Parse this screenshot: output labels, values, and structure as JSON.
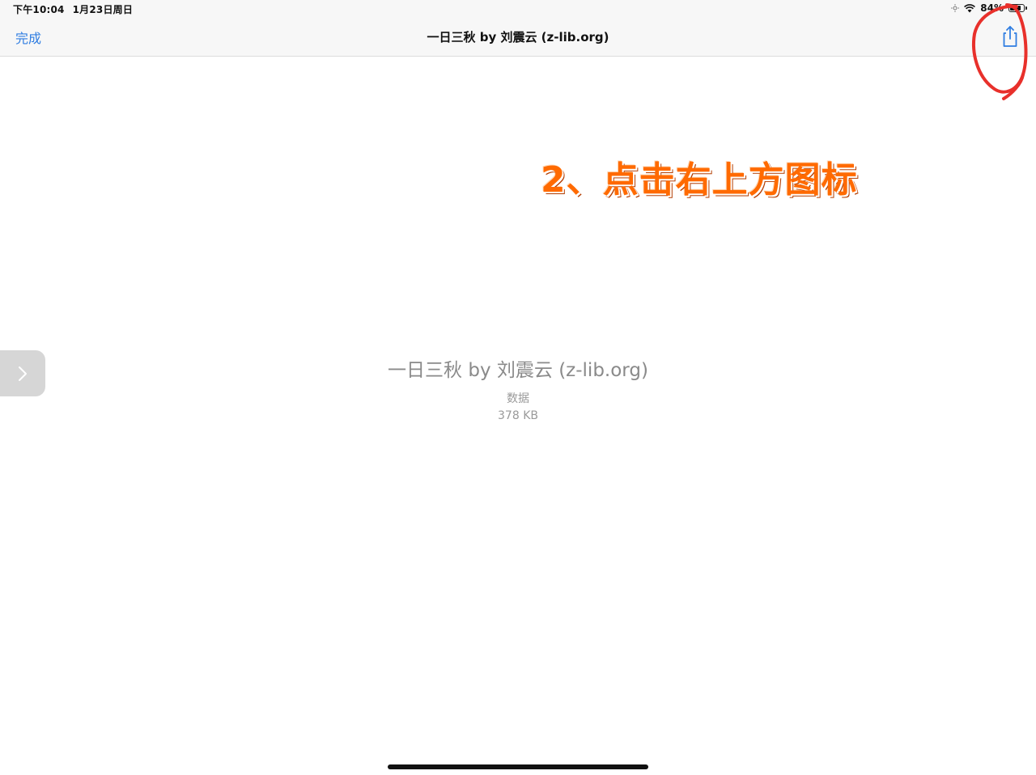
{
  "status_bar": {
    "time": "下午10:04",
    "date": "1月23日周日",
    "battery_percent": "84%",
    "battery_level": 0.84
  },
  "nav_bar": {
    "done_label": "完成",
    "title": "一日三秋 by 刘震云 (z-lib.org)",
    "share_icon": "share-icon"
  },
  "annotation": {
    "instruction_text": "2、点击右上方图标",
    "color": "#ff6a00",
    "circle_color": "#e8302b"
  },
  "file": {
    "name": "一日三秋 by 刘震云 (z-lib.org)",
    "kind": "数据",
    "size": "378 KB"
  },
  "side_tab": {
    "icon": "chevron-right-icon"
  },
  "colors": {
    "accent": "#2f7de1",
    "background": "#ffffff",
    "bar_background": "#f7f7f7"
  }
}
